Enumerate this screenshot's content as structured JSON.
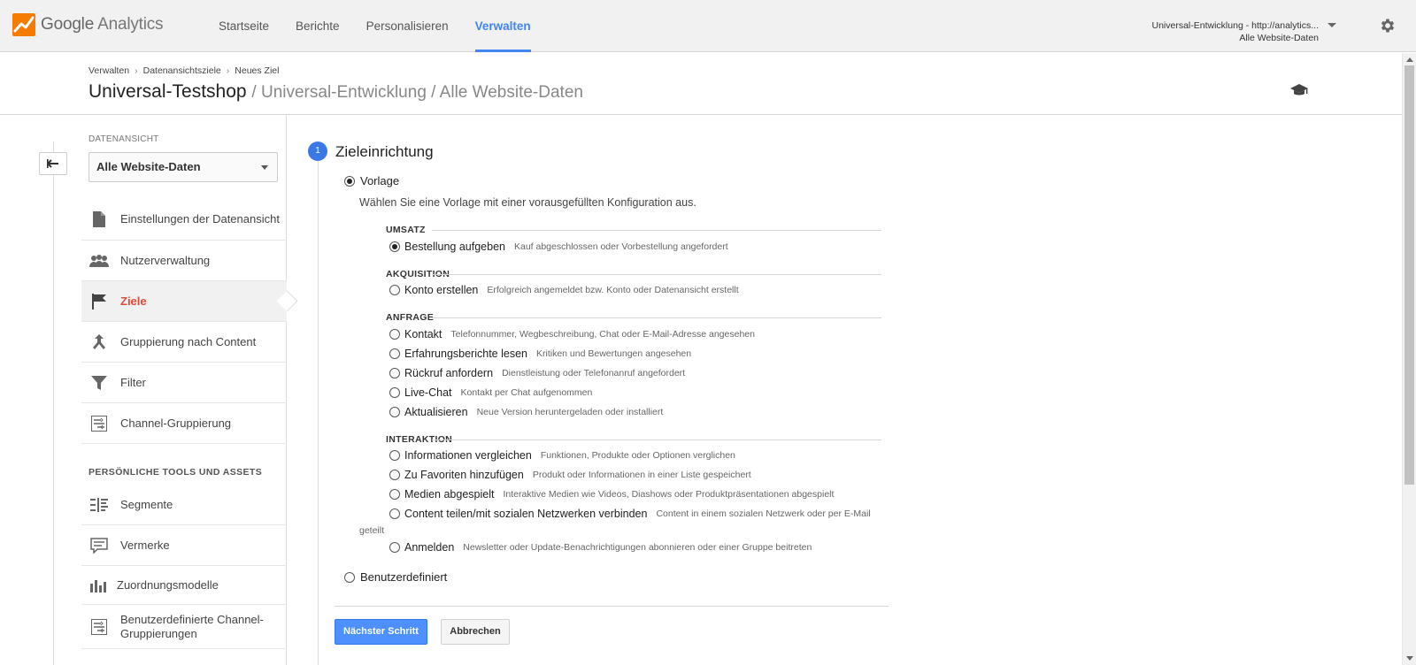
{
  "app": {
    "logo_google": "Google",
    "logo_product": "Analytics",
    "icon": "analytics-logo-icon"
  },
  "nav": {
    "items": [
      {
        "label": "Startseite"
      },
      {
        "label": "Berichte"
      },
      {
        "label": "Personalisieren"
      },
      {
        "label": "Verwalten",
        "active": true
      }
    ]
  },
  "account": {
    "line1": "Universal-Entwicklung - http://analytics...",
    "line2": "Alle Website-Daten"
  },
  "breadcrumb": [
    "Verwalten",
    "Datenansichtsziele",
    "Neues Ziel"
  ],
  "page_title": {
    "main": "Universal-Testshop",
    "sub": "/ Universal-Entwicklung / Alle Website-Daten"
  },
  "sidebar": {
    "caption": "DATENANSICHT",
    "select_value": "Alle Website-Daten",
    "items": [
      {
        "label": "Einstellungen der Datenansicht",
        "icon": "document-icon"
      },
      {
        "label": "Nutzerverwaltung",
        "icon": "users-icon"
      },
      {
        "label": "Ziele",
        "icon": "flag-icon",
        "active": true
      },
      {
        "label": "Gruppierung nach Content",
        "icon": "grouping-icon"
      },
      {
        "label": "Filter",
        "icon": "filter-icon"
      },
      {
        "label": "Channel-Gruppierung",
        "icon": "channel-grouping-icon"
      }
    ],
    "section_title": "PERSÖNLICHE TOOLS UND ASSETS",
    "tools": [
      {
        "label": "Segmente",
        "icon": "segments-icon"
      },
      {
        "label": "Vermerke",
        "icon": "annotations-icon"
      },
      {
        "label": "Zuordnungsmodelle",
        "icon": "attribution-icon"
      },
      {
        "label": "Benutzerdefinierte Channel-Gruppierungen",
        "icon": "custom-channel-icon"
      }
    ]
  },
  "step": {
    "number": "1",
    "title": "Zieleinrichtung"
  },
  "template": {
    "label": "Vorlage",
    "description": "Wählen Sie eine Vorlage mit einer vorausgefüllten Konfiguration aus.",
    "groups": [
      {
        "title": "UMSATZ",
        "options": [
          {
            "name": "Bestellung aufgeben",
            "desc": "Kauf abgeschlossen oder Vorbestellung angefordert",
            "selected": true
          }
        ]
      },
      {
        "title": "AKQUISITION",
        "options": [
          {
            "name": "Konto erstellen",
            "desc": "Erfolgreich angemeldet bzw. Konto oder Datenansicht erstellt"
          }
        ]
      },
      {
        "title": "ANFRAGE",
        "options": [
          {
            "name": "Kontakt",
            "desc": "Telefonnummer, Wegbeschreibung, Chat oder E-Mail-Adresse angesehen"
          },
          {
            "name": "Erfahrungsberichte lesen",
            "desc": "Kritiken und Bewertungen angesehen"
          },
          {
            "name": "Rückruf anfordern",
            "desc": "Dienstleistung oder Telefonanruf angefordert"
          },
          {
            "name": "Live-Chat",
            "desc": "Kontakt per Chat aufgenommen"
          },
          {
            "name": "Aktualisieren",
            "desc": "Neue Version heruntergeladen oder installiert"
          }
        ]
      },
      {
        "title": "INTERAKTION",
        "options": [
          {
            "name": "Informationen vergleichen",
            "desc": "Funktionen, Produkte oder Optionen verglichen"
          },
          {
            "name": "Zu Favoriten hinzufügen",
            "desc": "Produkt oder Informationen in einer Liste gespeichert"
          },
          {
            "name": "Medien abgespielt",
            "desc": "Interaktive Medien wie Videos, Diashows oder Produktpräsentationen abgespielt"
          },
          {
            "name": "Content teilen/mit sozialen Netzwerken verbinden",
            "desc": "Content in einem sozialen Netzwerk oder per E-Mail",
            "desc_wrap": "geteilt"
          },
          {
            "name": "Anmelden",
            "desc": "Newsletter oder Update-Benachrichtigungen abonnieren oder einer Gruppe beitreten"
          }
        ]
      }
    ]
  },
  "custom": {
    "label": "Benutzerdefiniert"
  },
  "buttons": {
    "next": "Nächster Schritt",
    "cancel": "Abbrechen"
  },
  "colors": {
    "accent": "#4285f4",
    "active_nav_item": "#dd4b39",
    "primary_button": "#4d90fe",
    "step_badge": "#3b78e7"
  }
}
